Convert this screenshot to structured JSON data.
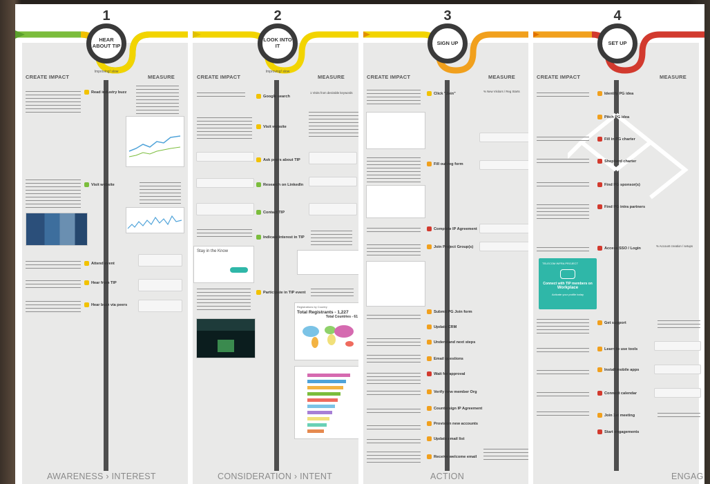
{
  "stages": [
    {
      "number": "1",
      "circle": "HEAR ABOUT TIP",
      "sub": "Improving!\nslow",
      "left": "CREATE IMPACT",
      "right": "MEASURE",
      "footer": "AWARENESS › INTEREST"
    },
    {
      "number": "2",
      "circle": "LOOK INTO IT",
      "sub": "Improving!\nslow",
      "left": "CREATE IMPACT",
      "right": "MEASURE",
      "footer": "CONSIDERATION › INTENT"
    },
    {
      "number": "3",
      "circle": "SIGN UP",
      "sub": "",
      "left": "CREATE IMPACT",
      "right": "MEASURE",
      "footer": "ACTION"
    },
    {
      "number": "4",
      "circle": "SET UP",
      "sub": "",
      "left": "CREATE IMPACT",
      "right": "MEASURE",
      "footer": "ENGAG"
    }
  ],
  "steps1": [
    "Read industry buzz",
    "Visit website",
    "Attend event",
    "Hear from TIP",
    "Hear buzz via peers"
  ],
  "steps2": [
    "Google search",
    "Visit website",
    "Ask peers about TIP",
    "Research on LinkedIn",
    "Contact TIP",
    "Indicate interest in TIP",
    "Participate in TIP event"
  ],
  "steps3": [
    "Click \"Join\"",
    "Fill out reg form",
    "Complete IP Agreement",
    "Join Project Group(s)",
    "Submit PG Join form",
    "Update CRM",
    "Understand next steps",
    "Email questions",
    "Wait for approval",
    "Verify new member Org",
    "Countersign IP Agreement",
    "Provision new accounts",
    "Update email list",
    "Receive welcome email"
  ],
  "steps4": [
    "Identify PG idea",
    "Pitch PG idea",
    "Fill in PG charter",
    "Shepherd charter",
    "Find PG sponsor(s)",
    "Find PG intra partners",
    "Access SSO / Login",
    "Get support",
    "Learn to use tools",
    "Install mobile apps",
    "Connect calendar",
    "Join 1st meeting",
    "Start engagements"
  ],
  "measures": {
    "m1": "1 Visits from desirable keywords",
    "m2": "% New Visitors / Reg Starts",
    "m3": "% Account creation / setups"
  },
  "chart_small": {
    "title": "Total Registrants - 1,227",
    "sub": "Total Countries - 61",
    "header": "Registrations by Country"
  },
  "promo": {
    "line1": "TELECOM INFRA PROJECT",
    "line2": "Connect with TIP members on",
    "line3": "Workplace",
    "line4": "Activate your profile today"
  },
  "stay": {
    "title": "Stay in the Know"
  },
  "colors": {
    "yellow": "#f2c200",
    "green": "#7bbd3c",
    "orange": "#f1a01d",
    "red": "#d23a2e",
    "teal": "#2fb7a8"
  }
}
